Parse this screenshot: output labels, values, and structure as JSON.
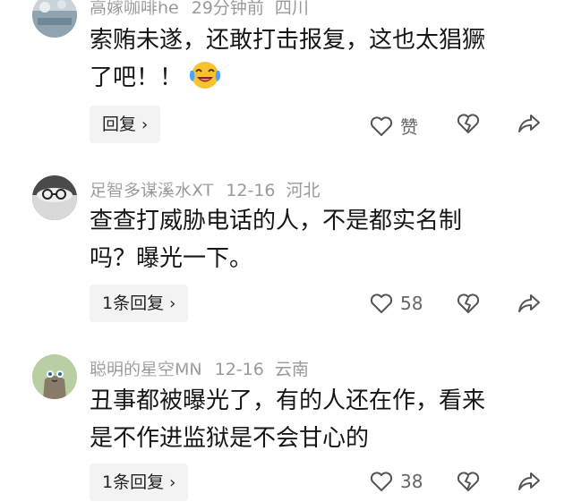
{
  "comments": [
    {
      "name": "高嫁咖啡he",
      "time": "29分钟前",
      "location": "四川",
      "lines": [
        "索贿未遂，还敢打击报复，这也太猖獗",
        "了吧！！"
      ],
      "reply_label": "回复",
      "like_label": "赞",
      "emoji": "laughing-crying-emoji"
    },
    {
      "name": "足智多谋溪水XT",
      "time": "12-16",
      "location": "河北",
      "lines": [
        "查查打威胁电话的人，不是都实名制",
        "吗？曝光一下。"
      ],
      "reply_label": "1条回复",
      "like_label": "58"
    },
    {
      "name": "聪明的星空MN",
      "time": "12-16",
      "location": "云南",
      "lines": [
        "丑事都被曝光了，有的人还在作，看来",
        "是不作进监狱是不会甘心的"
      ],
      "reply_label": "1条回复",
      "like_label": "38"
    }
  ],
  "colors": {
    "text": "#161616",
    "meta": "#9a9a9a",
    "button_bg": "#f3f3f3",
    "icon": "#555555"
  }
}
